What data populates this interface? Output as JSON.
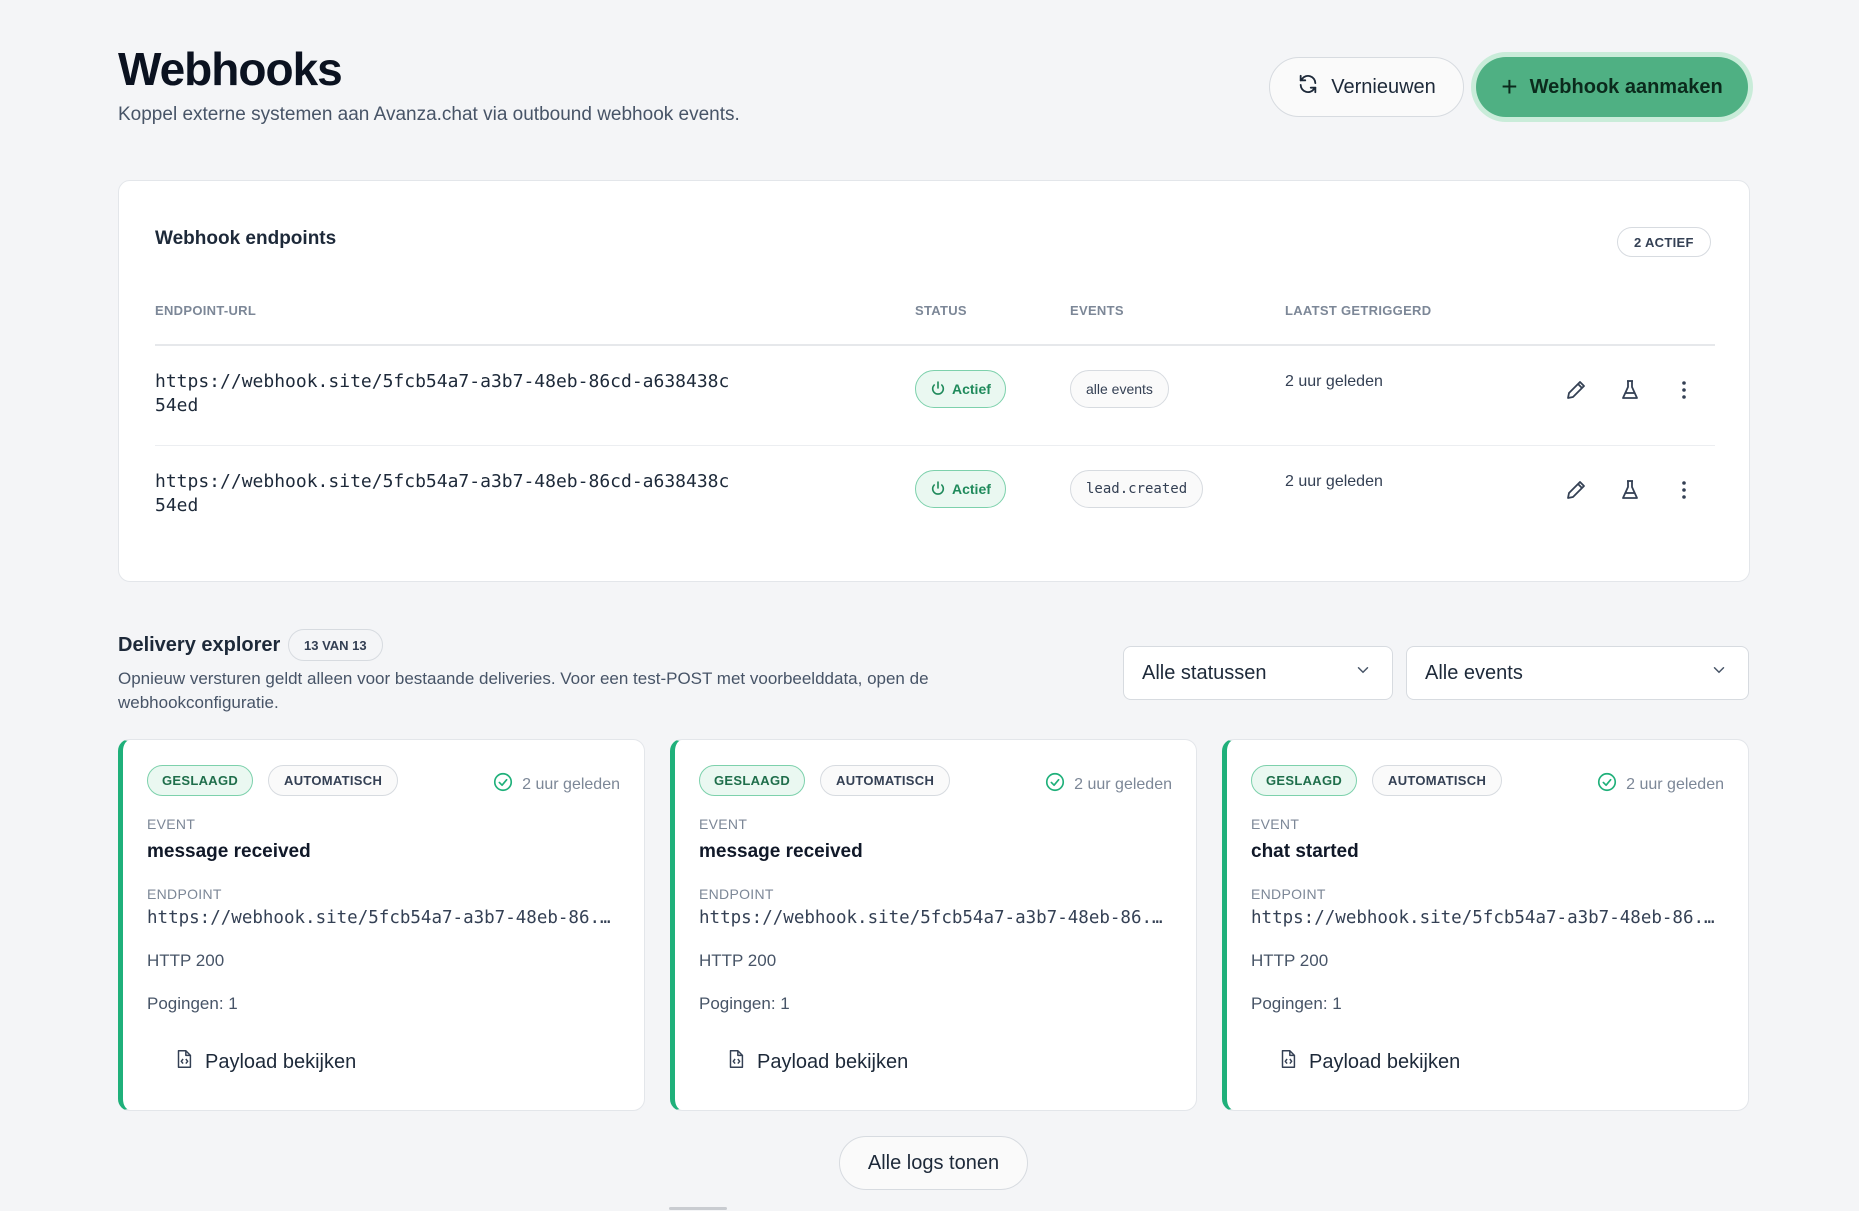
{
  "header": {
    "title": "Webhooks",
    "subtitle": "Koppel externe systemen aan Avanza.chat via outbound webhook events.",
    "refresh_label": "Vernieuwen",
    "create_label": "Webhook aanmaken"
  },
  "endpoints": {
    "title": "Webhook endpoints",
    "active_count": "2 ACTIEF",
    "columns": {
      "url": "ENDPOINT-URL",
      "status": "STATUS",
      "events": "EVENTS",
      "last": "LAATST GETRIGGERD"
    },
    "rows": [
      {
        "url": "https://webhook.site/5fcb54a7-a3b7-48eb-86cd-a638438c54ed",
        "status": "Actief",
        "events": "alle events",
        "last": "2 uur geleden"
      },
      {
        "url": "https://webhook.site/5fcb54a7-a3b7-48eb-86cd-a638438c54ed",
        "status": "Actief",
        "events": "lead.created",
        "last": "2 uur geleden"
      }
    ]
  },
  "explorer": {
    "title": "Delivery explorer",
    "count": "13 VAN 13",
    "description": "Opnieuw versturen geldt alleen voor bestaande deliveries. Voor een test-POST met voorbeelddata, open de webhookconfiguratie.",
    "status_filter": "Alle statussen",
    "event_filter": "Alle events",
    "show_all_label": "Alle logs tonen",
    "deliveries": [
      {
        "result": "GESLAAGD",
        "mode": "AUTOMATISCH",
        "time": "2 uur geleden",
        "event_label": "EVENT",
        "event": "message received",
        "endpoint_label": "ENDPOINT",
        "endpoint": "https://webhook.site/5fcb54a7-a3b7-48eb-86...",
        "http": "HTTP 200",
        "attempts": "Pogingen: 1",
        "payload_label": "Payload bekijken"
      },
      {
        "result": "GESLAAGD",
        "mode": "AUTOMATISCH",
        "time": "2 uur geleden",
        "event_label": "EVENT",
        "event": "message received",
        "endpoint_label": "ENDPOINT",
        "endpoint": "https://webhook.site/5fcb54a7-a3b7-48eb-86...",
        "http": "HTTP 200",
        "attempts": "Pogingen: 1",
        "payload_label": "Payload bekijken"
      },
      {
        "result": "GESLAAGD",
        "mode": "AUTOMATISCH",
        "time": "2 uur geleden",
        "event_label": "EVENT",
        "event": "chat started",
        "endpoint_label": "ENDPOINT",
        "endpoint": "https://webhook.site/5fcb54a7-a3b7-48eb-86...",
        "http": "HTTP 200",
        "attempts": "Pogingen: 1",
        "payload_label": "Payload bekijken"
      }
    ]
  },
  "colors": {
    "accent": "#4fb083",
    "success": "#1fb07a",
    "background": "#f4f5f7"
  }
}
